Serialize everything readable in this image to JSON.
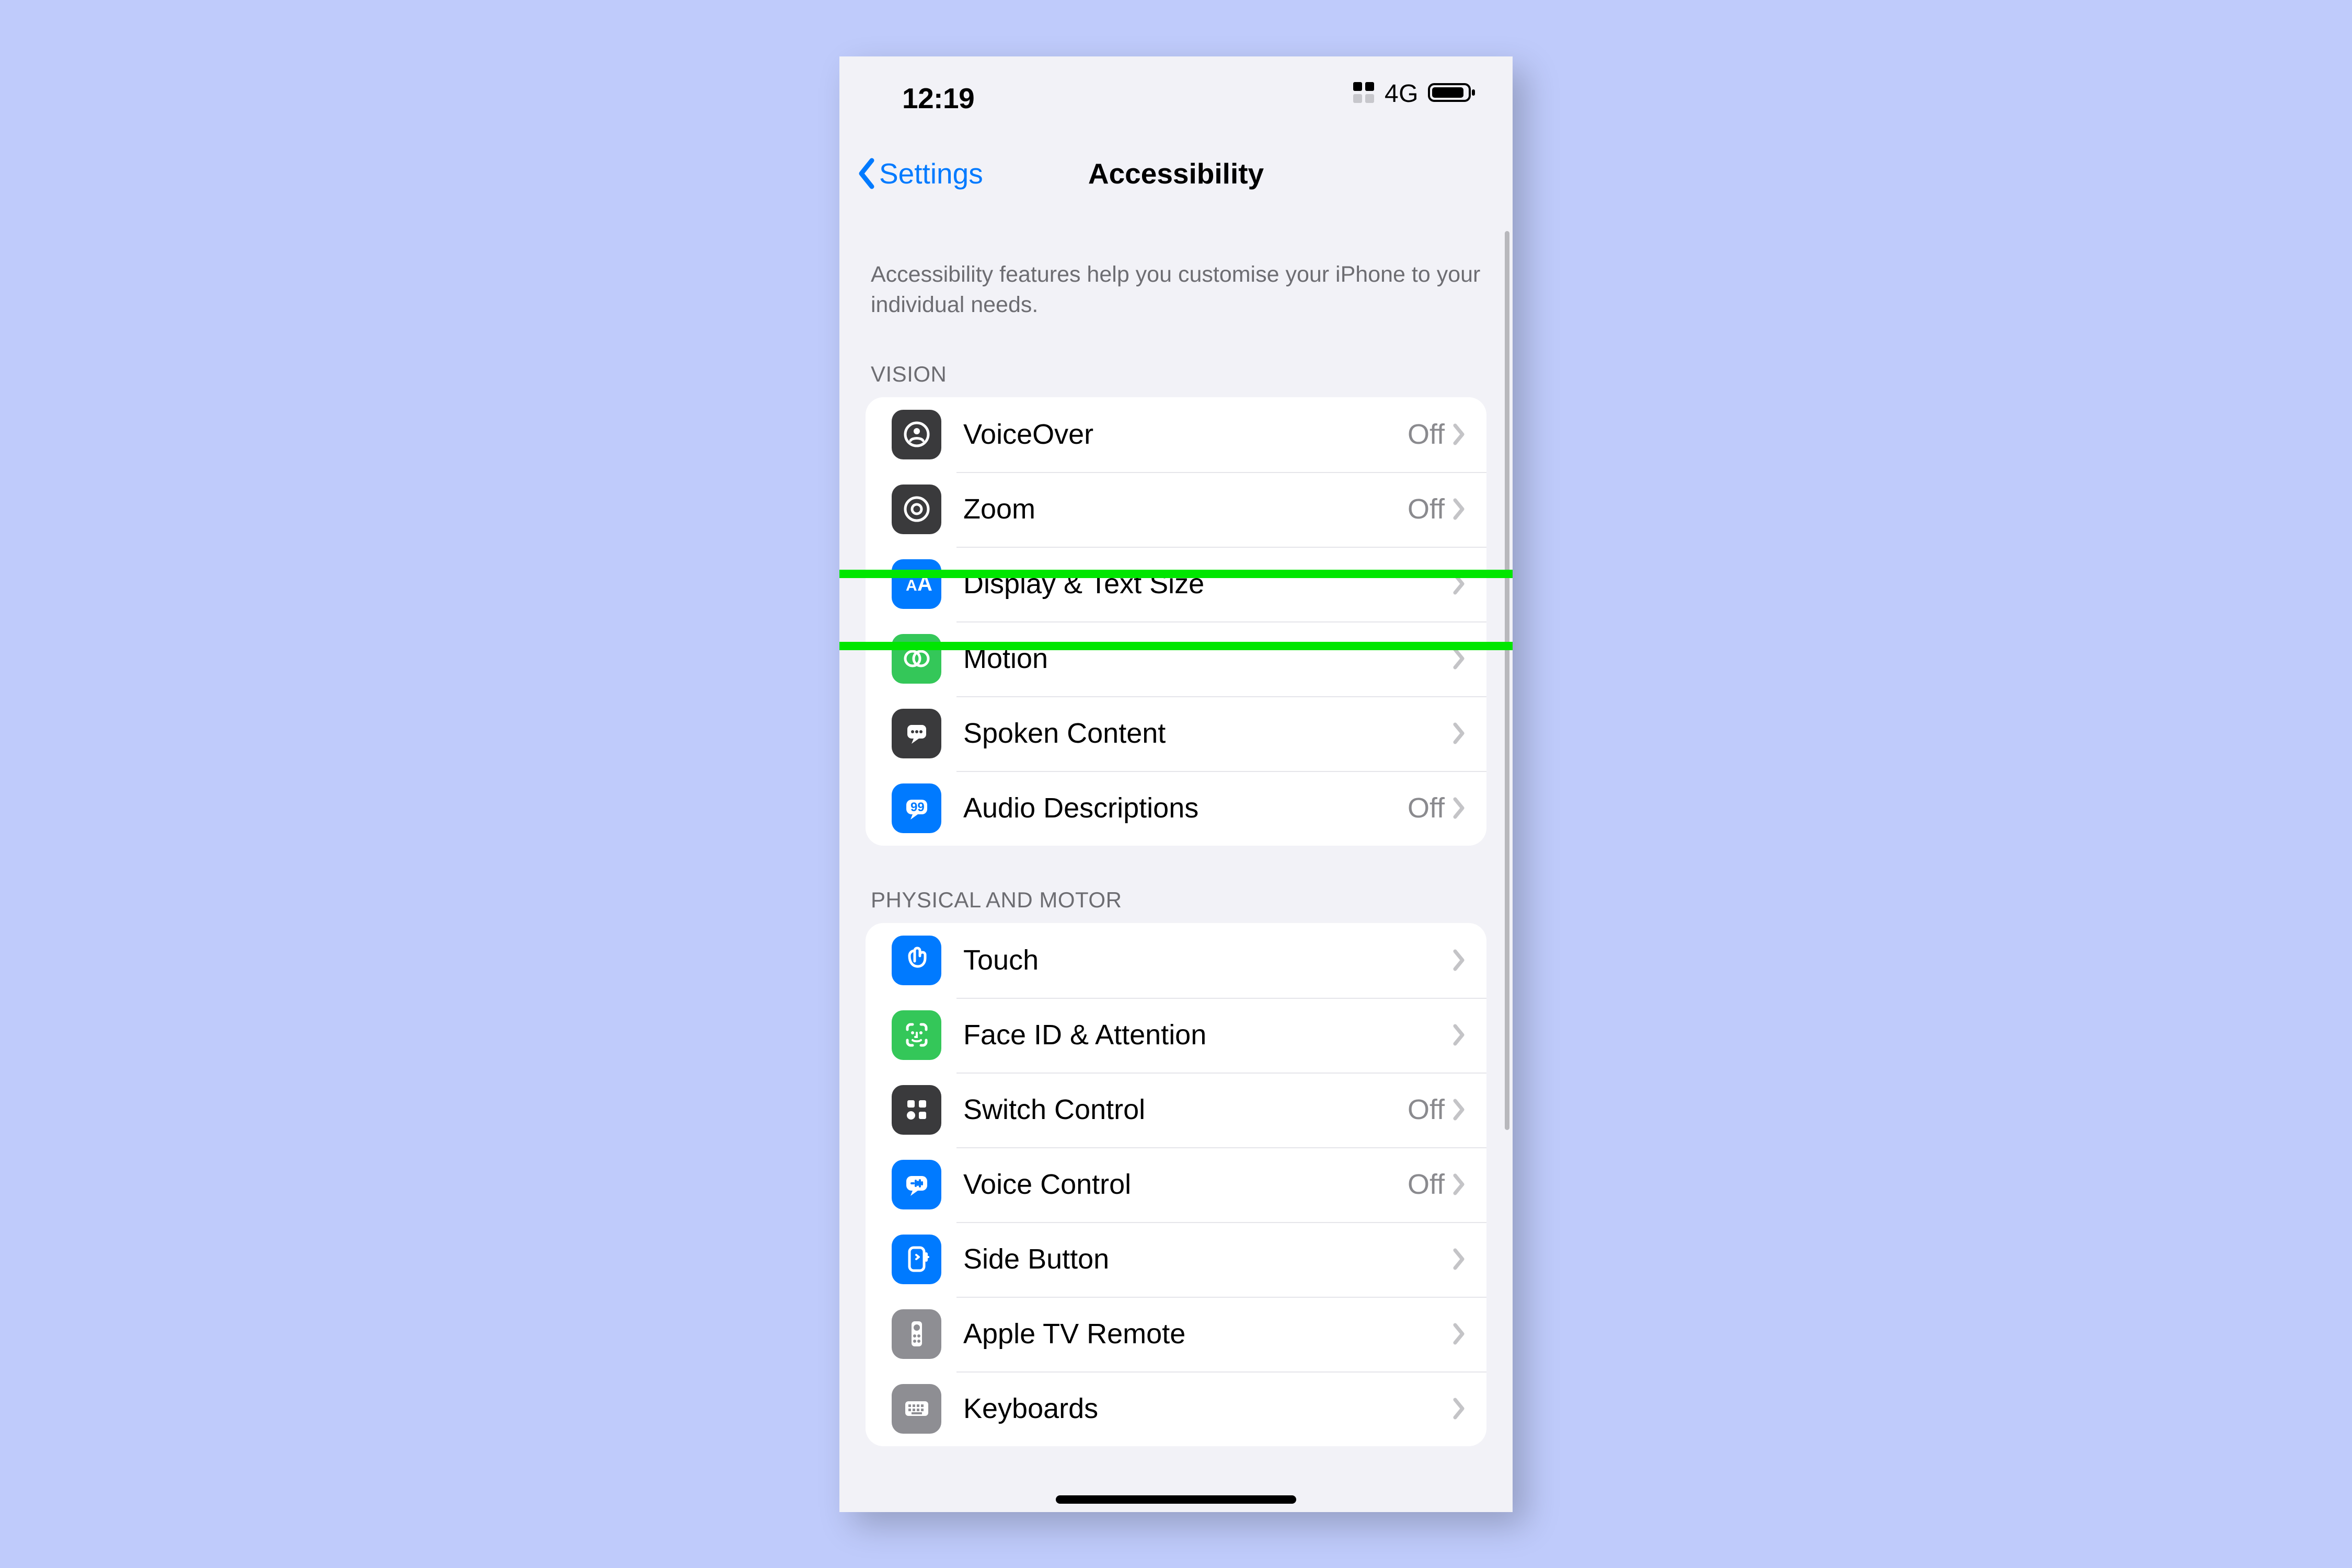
{
  "status": {
    "time": "12:19",
    "network": "4G"
  },
  "nav": {
    "back": "Settings",
    "title": "Accessibility"
  },
  "description": "Accessibility features help you customise your iPhone to your individual needs.",
  "sections": {
    "vision": {
      "header": "VISION",
      "voiceover": {
        "label": "VoiceOver",
        "status": "Off"
      },
      "zoom": {
        "label": "Zoom",
        "status": "Off"
      },
      "display": {
        "label": "Display & Text Size",
        "status": ""
      },
      "motion": {
        "label": "Motion",
        "status": ""
      },
      "spoken": {
        "label": "Spoken Content",
        "status": ""
      },
      "audio": {
        "label": "Audio Descriptions",
        "status": "Off"
      }
    },
    "physical": {
      "header": "PHYSICAL AND MOTOR",
      "touch": {
        "label": "Touch",
        "status": ""
      },
      "faceid": {
        "label": "Face ID & Attention",
        "status": ""
      },
      "switchctl": {
        "label": "Switch Control",
        "status": "Off"
      },
      "voicectl": {
        "label": "Voice Control",
        "status": "Off"
      },
      "sidebtn": {
        "label": "Side Button",
        "status": ""
      },
      "appletv": {
        "label": "Apple TV Remote",
        "status": ""
      },
      "keyboards": {
        "label": "Keyboards",
        "status": ""
      }
    }
  },
  "highlighted_row": "display"
}
